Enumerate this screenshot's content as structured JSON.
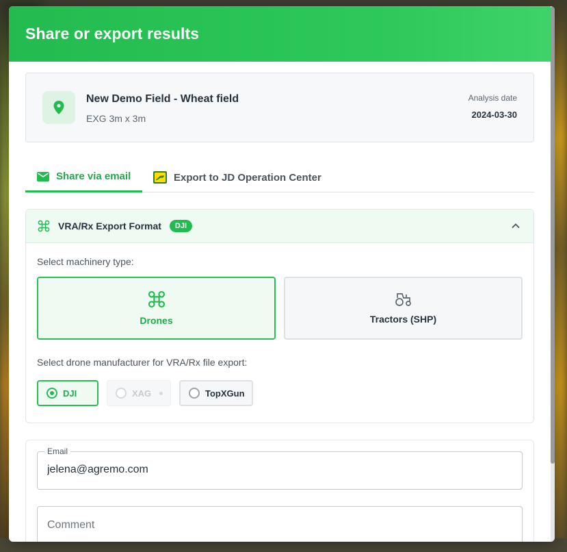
{
  "modal": {
    "title": "Share or export results"
  },
  "field": {
    "name": "New Demo Field - Wheat field",
    "subtitle": "EXG 3m x 3m",
    "date_label": "Analysis date",
    "date_value": "2024-03-30",
    "icon": "map-pin-icon"
  },
  "tabs": [
    {
      "label": "Share via email",
      "icon": "mail-icon",
      "active": true
    },
    {
      "label": "Export to JD Operation Center",
      "icon": "john-deere-icon",
      "active": false
    }
  ],
  "export_format": {
    "title": "VRA/Rx Export Format",
    "badge": "DJI",
    "icon": "drone-icon",
    "expanded": true,
    "machinery_label": "Select machinery type:",
    "machinery": [
      {
        "label": "Drones",
        "icon": "drone-icon",
        "selected": true
      },
      {
        "label": "Tractors (SHP)",
        "icon": "tractor-icon",
        "selected": false
      }
    ],
    "manufacturer_label": "Select drone manufacturer for VRA/Rx file export:",
    "manufacturers": [
      {
        "label": "DJI",
        "selected": true,
        "disabled": false
      },
      {
        "label": "XAG",
        "selected": false,
        "disabled": true
      },
      {
        "label": "TopXGun",
        "selected": false,
        "disabled": false
      }
    ]
  },
  "email": {
    "legend": "Email",
    "value": "jelena@agremo.com"
  },
  "comment": {
    "placeholder": "Comment"
  },
  "colors": {
    "accent": "#22bb4f",
    "accent_text": "#22a84a",
    "header_gradient_end": "#3fd36a"
  }
}
